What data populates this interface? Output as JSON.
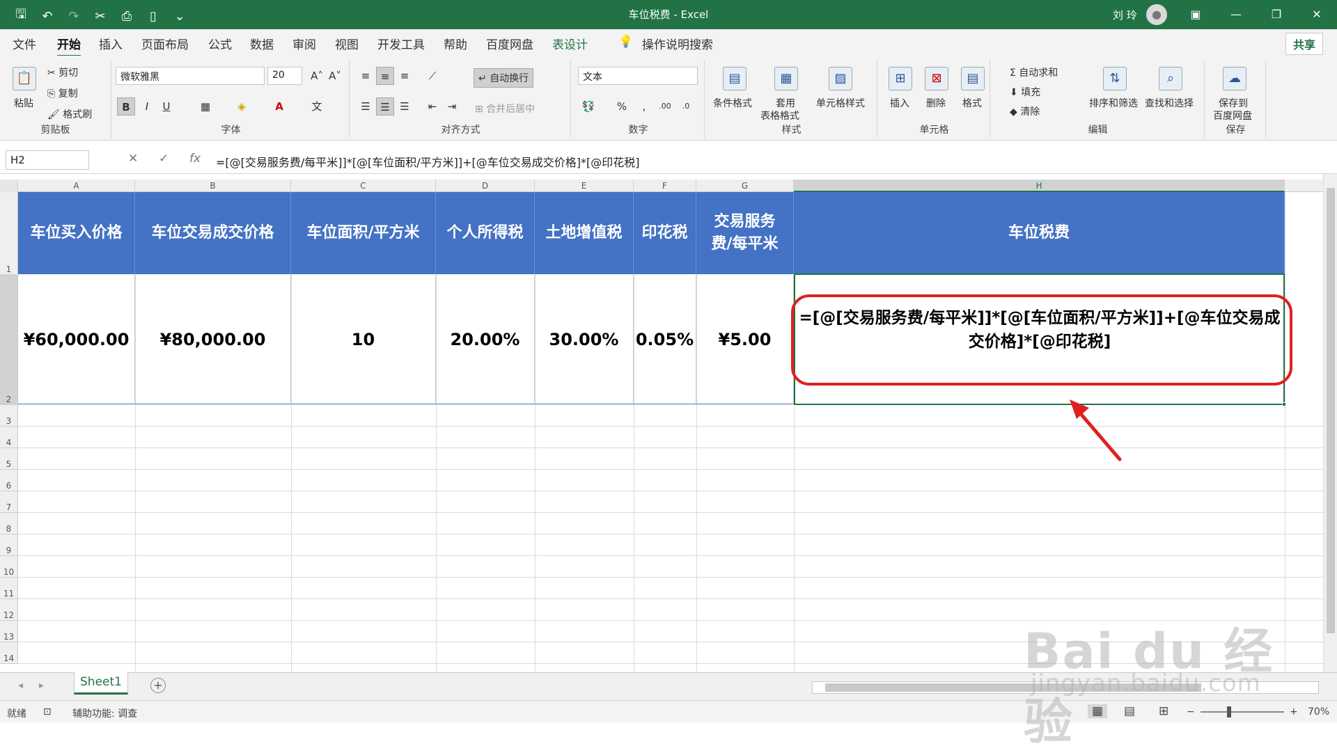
{
  "app": {
    "title": "车位税费 - Excel",
    "user": "刘 玲",
    "share": "共享"
  },
  "ribbon_tabs": [
    "文件",
    "开始",
    "插入",
    "页面布局",
    "公式",
    "数据",
    "审阅",
    "视图",
    "开发工具",
    "帮助",
    "百度网盘",
    "表设计",
    "操作说明搜索"
  ],
  "ribbon": {
    "clipboard": {
      "paste": "粘贴",
      "cut": "剪切",
      "copy": "复制",
      "format_painter": "格式刷",
      "label": "剪贴板"
    },
    "font": {
      "name": "微软雅黑",
      "size": "20",
      "label": "字体"
    },
    "alignment": {
      "wrap": "自动换行",
      "merge": "合并后居中",
      "label": "对齐方式"
    },
    "number": {
      "format": "文本",
      "label": "数字"
    },
    "styles": {
      "conditional": "条件格式",
      "table_format_1": "套用",
      "table_format_2": "表格格式",
      "cell_styles": "单元格样式",
      "label": "样式"
    },
    "cells": {
      "insert": "插入",
      "delete": "删除",
      "format": "格式",
      "label": "单元格"
    },
    "editing": {
      "autosum": "自动求和",
      "fill": "填充",
      "clear": "清除",
      "sort": "排序和筛选",
      "find": "查找和选择",
      "label": "编辑"
    },
    "save": {
      "save_1": "保存到",
      "save_2": "百度网盘",
      "label": "保存"
    }
  },
  "formula_bar": {
    "name_box": "H2",
    "fx": "fx",
    "formula": "=[@[交易服务费/每平米]]*[@[车位面积/平方米]]+[@车位交易成交价格]*[@印花税]"
  },
  "sheet": {
    "columns": [
      "A",
      "B",
      "C",
      "D",
      "E",
      "F",
      "G",
      "H"
    ],
    "rows": [
      "1",
      "2",
      "3",
      "4",
      "5",
      "6",
      "7",
      "8",
      "9",
      "10",
      "11",
      "12",
      "13",
      "14"
    ],
    "headers": [
      "车位买入价格",
      "车位交易成交价格",
      "车位面积/平方米",
      "个人所得税",
      "土地增值税",
      "印花税",
      "交易服务费/每平米",
      "车位税费"
    ],
    "row2": [
      "¥60,000.00",
      "¥80,000.00",
      "10",
      "20.00%",
      "30.00%",
      "0.05%",
      "¥5.00",
      "=[@[交易服务费/每平米]]*[@[车位面积/平方米]]+[@车位交易成交价格]*[@印花税]"
    ],
    "selected_cell": "H2"
  },
  "sheet_tabs": {
    "active": "Sheet1"
  },
  "status": {
    "ready": "就绪",
    "accessibility": "辅助功能: 调查",
    "zoom": "70%"
  },
  "watermark": {
    "line1": "Bai du 经验",
    "line2": "jingyan.baidu.com"
  },
  "colors": {
    "excel_green": "#217346",
    "header_blue": "#4472c4",
    "annotation_red": "#e02020"
  }
}
